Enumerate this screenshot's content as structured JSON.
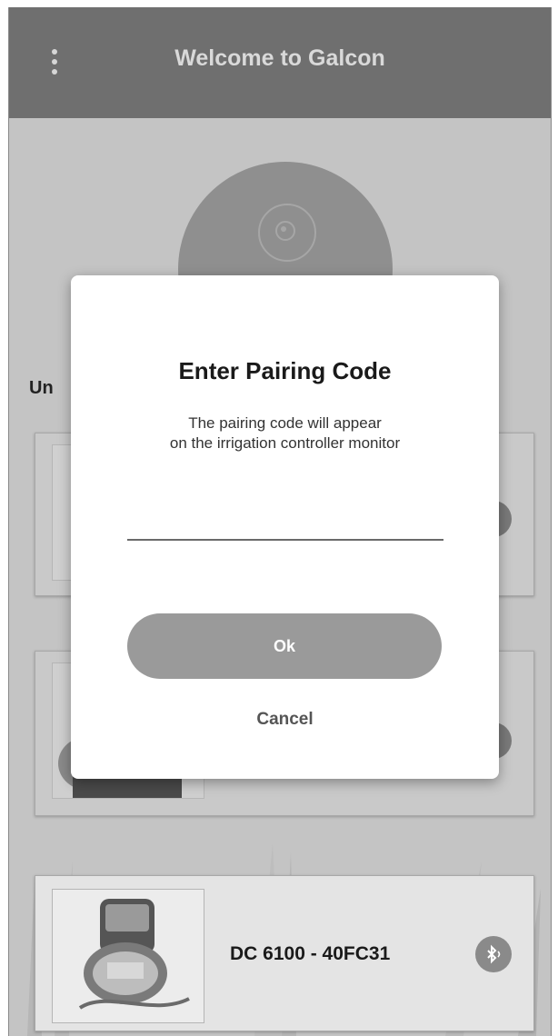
{
  "appbar": {
    "title": "Welcome to Galcon"
  },
  "section": {
    "label": "Un"
  },
  "devices": [
    {
      "name": "DC 6100 - 40FC31"
    }
  ],
  "dialog": {
    "title": "Enter Pairing Code",
    "message_line1": "The pairing code will appear",
    "message_line2": "on the irrigation controller monitor",
    "input_value": "",
    "ok_label": "Ok",
    "cancel_label": "Cancel"
  },
  "icons": {
    "menu": "more-vert-icon",
    "bluetooth": "bluetooth-icon"
  }
}
